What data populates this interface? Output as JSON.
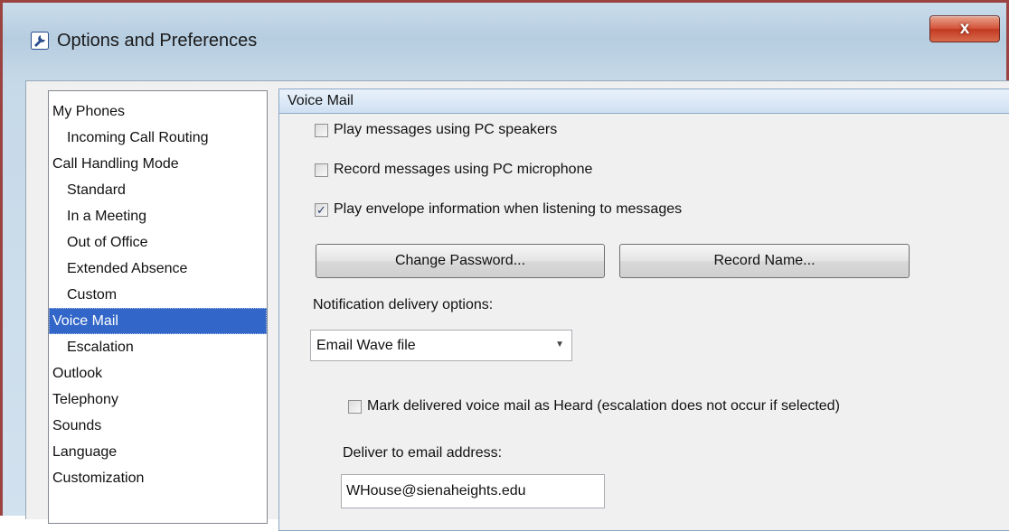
{
  "window": {
    "title": "Options and Preferences",
    "close_glyph": "x"
  },
  "nav": {
    "items": [
      {
        "label": "My Phones",
        "level": 0
      },
      {
        "label": "Incoming Call Routing",
        "level": 1
      },
      {
        "label": "Call Handling Mode",
        "level": 0
      },
      {
        "label": "Standard",
        "level": 1
      },
      {
        "label": "In a Meeting",
        "level": 1
      },
      {
        "label": "Out of Office",
        "level": 1
      },
      {
        "label": "Extended Absence",
        "level": 1
      },
      {
        "label": "Custom",
        "level": 1
      },
      {
        "label": "Voice Mail",
        "level": 0,
        "selected": true
      },
      {
        "label": "Escalation",
        "level": 1
      },
      {
        "label": "Outlook",
        "level": 0
      },
      {
        "label": "Telephony",
        "level": 0
      },
      {
        "label": "Sounds",
        "level": 0
      },
      {
        "label": "Language",
        "level": 0
      },
      {
        "label": "Customization",
        "level": 0
      }
    ]
  },
  "voicemail": {
    "header": "Voice Mail",
    "play_pc_speakers": {
      "label": "Play messages using PC speakers",
      "checked": false
    },
    "record_pc_mic": {
      "label": "Record messages using PC microphone",
      "checked": false
    },
    "play_envelope": {
      "label": "Play envelope information when listening to messages",
      "checked": true
    },
    "change_password_label": "Change Password...",
    "record_name_label": "Record Name...",
    "notification_label": "Notification delivery options:",
    "notification_selected": "Email Wave file",
    "mark_heard": {
      "label": "Mark delivered voice mail as Heard (escalation does not occur if selected)",
      "checked": false
    },
    "deliver_email_label": "Deliver to email address:",
    "email_value": "WHouse@sienaheights.edu"
  },
  "colors": {
    "selection": "#3266c8",
    "close_button": "#c13a22",
    "frame_border": "#9a4340"
  }
}
